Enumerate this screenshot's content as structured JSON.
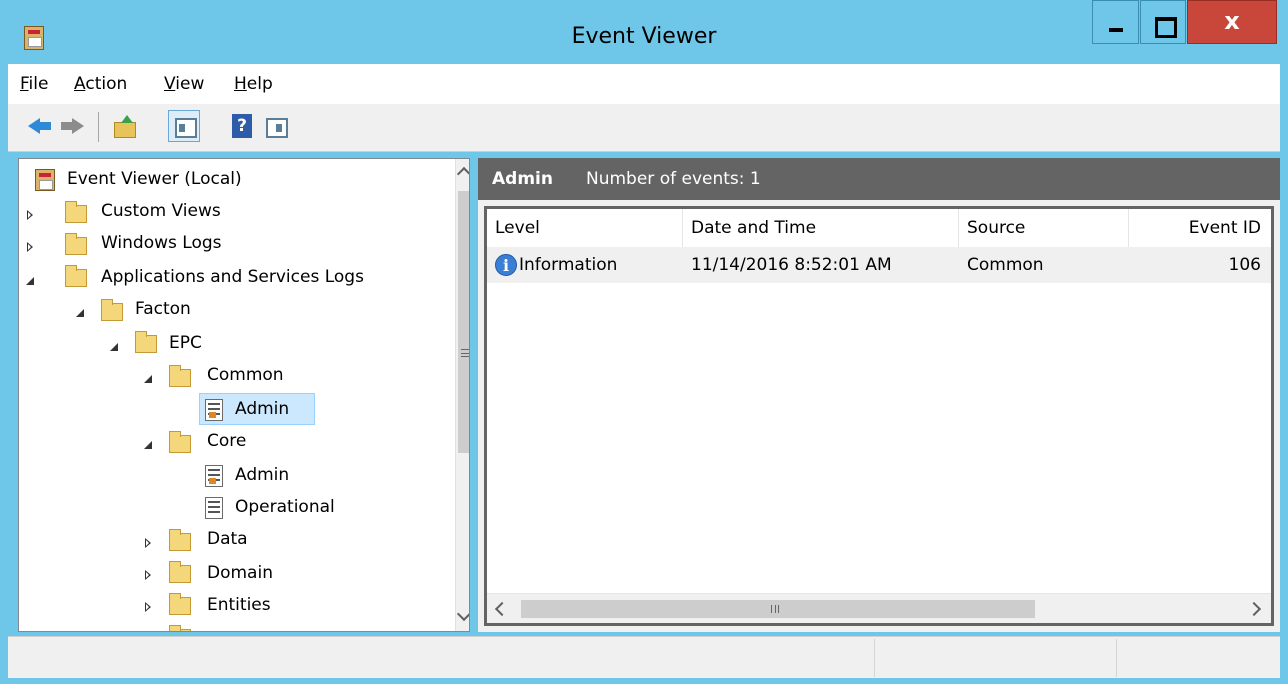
{
  "window": {
    "title": "Event Viewer",
    "controls": {
      "minimize": "minimize",
      "maximize": "maximize",
      "close": "close"
    }
  },
  "menu": [
    {
      "label": "File",
      "accel": "F",
      "rest": "ile"
    },
    {
      "label": "Action",
      "accel": "A",
      "rest": "ction"
    },
    {
      "label": "View",
      "accel": "V",
      "rest": "iew"
    },
    {
      "label": "Help",
      "accel": "H",
      "rest": "elp"
    }
  ],
  "toolbar": {
    "help_glyph": "?",
    "icons": [
      "back-arrow-icon",
      "forward-arrow-icon",
      "up-folder-icon",
      "show-hide-console-tree-icon",
      "help-icon",
      "show-hide-action-pane-icon"
    ]
  },
  "tree": {
    "root": "Event Viewer (Local)",
    "custom_views": "Custom Views",
    "windows_logs": "Windows Logs",
    "app_services": "Applications and Services Logs",
    "facton": "Facton",
    "epc": "EPC",
    "common": "Common",
    "common_admin": "Admin",
    "core": "Core",
    "core_admin": "Admin",
    "core_operational": "Operational",
    "data": "Data",
    "domain": "Domain",
    "entities": "Entities"
  },
  "detail": {
    "log_name": "Admin",
    "event_count_label": "Number of events: 1",
    "columns": [
      "Level",
      "Date and Time",
      "Source",
      "Event ID"
    ],
    "events": [
      {
        "level": "Information",
        "date_time": "11/14/2016 8:52:01 AM",
        "source": "Common",
        "event_id": "106"
      }
    ],
    "info_glyph": "i",
    "hscroll_grip": "III"
  },
  "colors": {
    "title_bar": "#6ec6e8",
    "close_button": "#c8473a",
    "header_band": "#646464",
    "selection": "#cce8ff"
  }
}
